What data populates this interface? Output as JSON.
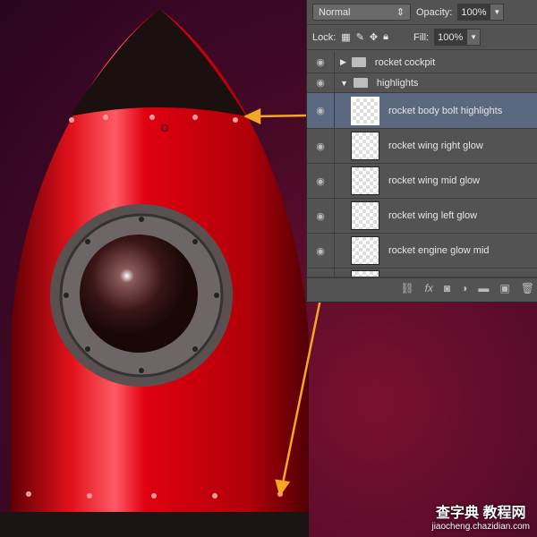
{
  "panel": {
    "blend_mode": "Normal",
    "opacity_label": "Opacity:",
    "opacity": "100%",
    "lock_label": "Lock:",
    "fill_label": "Fill:",
    "fill": "100%",
    "layers": [
      {
        "name": "rocket cockpit",
        "type": "group",
        "expanded": false
      },
      {
        "name": "highlights",
        "type": "group",
        "expanded": true
      },
      {
        "name": "rocket body bolt highlights",
        "type": "layer",
        "selected": true
      },
      {
        "name": "rocket wing right glow",
        "type": "layer"
      },
      {
        "name": "rocket wing mid glow",
        "type": "layer"
      },
      {
        "name": "rocket wing left glow",
        "type": "layer"
      },
      {
        "name": "rocket engine glow mid",
        "type": "layer"
      }
    ],
    "footer_icons": [
      "link-icon",
      "fx-icon",
      "mask-icon",
      "adjustment-icon",
      "folder-icon",
      "new-layer-icon",
      "trash-icon"
    ]
  },
  "colors": {
    "arrow": "#f5a623",
    "selected_row": "#5a6880",
    "rocket": "#d8000c"
  },
  "watermark": {
    "line1": "查字典 教程网",
    "line2": "jiaocheng.chazidian.com"
  }
}
